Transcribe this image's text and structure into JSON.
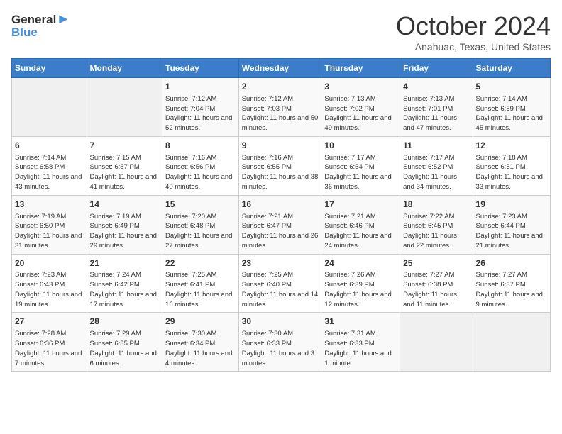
{
  "header": {
    "logo_line1": "General",
    "logo_line2": "Blue",
    "month": "October 2024",
    "location": "Anahuac, Texas, United States"
  },
  "days_of_week": [
    "Sunday",
    "Monday",
    "Tuesday",
    "Wednesday",
    "Thursday",
    "Friday",
    "Saturday"
  ],
  "weeks": [
    [
      {
        "day": "",
        "sunrise": "",
        "sunset": "",
        "daylight": ""
      },
      {
        "day": "",
        "sunrise": "",
        "sunset": "",
        "daylight": ""
      },
      {
        "day": "1",
        "sunrise": "Sunrise: 7:12 AM",
        "sunset": "Sunset: 7:04 PM",
        "daylight": "Daylight: 11 hours and 52 minutes."
      },
      {
        "day": "2",
        "sunrise": "Sunrise: 7:12 AM",
        "sunset": "Sunset: 7:03 PM",
        "daylight": "Daylight: 11 hours and 50 minutes."
      },
      {
        "day": "3",
        "sunrise": "Sunrise: 7:13 AM",
        "sunset": "Sunset: 7:02 PM",
        "daylight": "Daylight: 11 hours and 49 minutes."
      },
      {
        "day": "4",
        "sunrise": "Sunrise: 7:13 AM",
        "sunset": "Sunset: 7:01 PM",
        "daylight": "Daylight: 11 hours and 47 minutes."
      },
      {
        "day": "5",
        "sunrise": "Sunrise: 7:14 AM",
        "sunset": "Sunset: 6:59 PM",
        "daylight": "Daylight: 11 hours and 45 minutes."
      }
    ],
    [
      {
        "day": "6",
        "sunrise": "Sunrise: 7:14 AM",
        "sunset": "Sunset: 6:58 PM",
        "daylight": "Daylight: 11 hours and 43 minutes."
      },
      {
        "day": "7",
        "sunrise": "Sunrise: 7:15 AM",
        "sunset": "Sunset: 6:57 PM",
        "daylight": "Daylight: 11 hours and 41 minutes."
      },
      {
        "day": "8",
        "sunrise": "Sunrise: 7:16 AM",
        "sunset": "Sunset: 6:56 PM",
        "daylight": "Daylight: 11 hours and 40 minutes."
      },
      {
        "day": "9",
        "sunrise": "Sunrise: 7:16 AM",
        "sunset": "Sunset: 6:55 PM",
        "daylight": "Daylight: 11 hours and 38 minutes."
      },
      {
        "day": "10",
        "sunrise": "Sunrise: 7:17 AM",
        "sunset": "Sunset: 6:54 PM",
        "daylight": "Daylight: 11 hours and 36 minutes."
      },
      {
        "day": "11",
        "sunrise": "Sunrise: 7:17 AM",
        "sunset": "Sunset: 6:52 PM",
        "daylight": "Daylight: 11 hours and 34 minutes."
      },
      {
        "day": "12",
        "sunrise": "Sunrise: 7:18 AM",
        "sunset": "Sunset: 6:51 PM",
        "daylight": "Daylight: 11 hours and 33 minutes."
      }
    ],
    [
      {
        "day": "13",
        "sunrise": "Sunrise: 7:19 AM",
        "sunset": "Sunset: 6:50 PM",
        "daylight": "Daylight: 11 hours and 31 minutes."
      },
      {
        "day": "14",
        "sunrise": "Sunrise: 7:19 AM",
        "sunset": "Sunset: 6:49 PM",
        "daylight": "Daylight: 11 hours and 29 minutes."
      },
      {
        "day": "15",
        "sunrise": "Sunrise: 7:20 AM",
        "sunset": "Sunset: 6:48 PM",
        "daylight": "Daylight: 11 hours and 27 minutes."
      },
      {
        "day": "16",
        "sunrise": "Sunrise: 7:21 AM",
        "sunset": "Sunset: 6:47 PM",
        "daylight": "Daylight: 11 hours and 26 minutes."
      },
      {
        "day": "17",
        "sunrise": "Sunrise: 7:21 AM",
        "sunset": "Sunset: 6:46 PM",
        "daylight": "Daylight: 11 hours and 24 minutes."
      },
      {
        "day": "18",
        "sunrise": "Sunrise: 7:22 AM",
        "sunset": "Sunset: 6:45 PM",
        "daylight": "Daylight: 11 hours and 22 minutes."
      },
      {
        "day": "19",
        "sunrise": "Sunrise: 7:23 AM",
        "sunset": "Sunset: 6:44 PM",
        "daylight": "Daylight: 11 hours and 21 minutes."
      }
    ],
    [
      {
        "day": "20",
        "sunrise": "Sunrise: 7:23 AM",
        "sunset": "Sunset: 6:43 PM",
        "daylight": "Daylight: 11 hours and 19 minutes."
      },
      {
        "day": "21",
        "sunrise": "Sunrise: 7:24 AM",
        "sunset": "Sunset: 6:42 PM",
        "daylight": "Daylight: 11 hours and 17 minutes."
      },
      {
        "day": "22",
        "sunrise": "Sunrise: 7:25 AM",
        "sunset": "Sunset: 6:41 PM",
        "daylight": "Daylight: 11 hours and 16 minutes."
      },
      {
        "day": "23",
        "sunrise": "Sunrise: 7:25 AM",
        "sunset": "Sunset: 6:40 PM",
        "daylight": "Daylight: 11 hours and 14 minutes."
      },
      {
        "day": "24",
        "sunrise": "Sunrise: 7:26 AM",
        "sunset": "Sunset: 6:39 PM",
        "daylight": "Daylight: 11 hours and 12 minutes."
      },
      {
        "day": "25",
        "sunrise": "Sunrise: 7:27 AM",
        "sunset": "Sunset: 6:38 PM",
        "daylight": "Daylight: 11 hours and 11 minutes."
      },
      {
        "day": "26",
        "sunrise": "Sunrise: 7:27 AM",
        "sunset": "Sunset: 6:37 PM",
        "daylight": "Daylight: 11 hours and 9 minutes."
      }
    ],
    [
      {
        "day": "27",
        "sunrise": "Sunrise: 7:28 AM",
        "sunset": "Sunset: 6:36 PM",
        "daylight": "Daylight: 11 hours and 7 minutes."
      },
      {
        "day": "28",
        "sunrise": "Sunrise: 7:29 AM",
        "sunset": "Sunset: 6:35 PM",
        "daylight": "Daylight: 11 hours and 6 minutes."
      },
      {
        "day": "29",
        "sunrise": "Sunrise: 7:30 AM",
        "sunset": "Sunset: 6:34 PM",
        "daylight": "Daylight: 11 hours and 4 minutes."
      },
      {
        "day": "30",
        "sunrise": "Sunrise: 7:30 AM",
        "sunset": "Sunset: 6:33 PM",
        "daylight": "Daylight: 11 hours and 3 minutes."
      },
      {
        "day": "31",
        "sunrise": "Sunrise: 7:31 AM",
        "sunset": "Sunset: 6:33 PM",
        "daylight": "Daylight: 11 hours and 1 minute."
      },
      {
        "day": "",
        "sunrise": "",
        "sunset": "",
        "daylight": ""
      },
      {
        "day": "",
        "sunrise": "",
        "sunset": "",
        "daylight": ""
      }
    ]
  ]
}
